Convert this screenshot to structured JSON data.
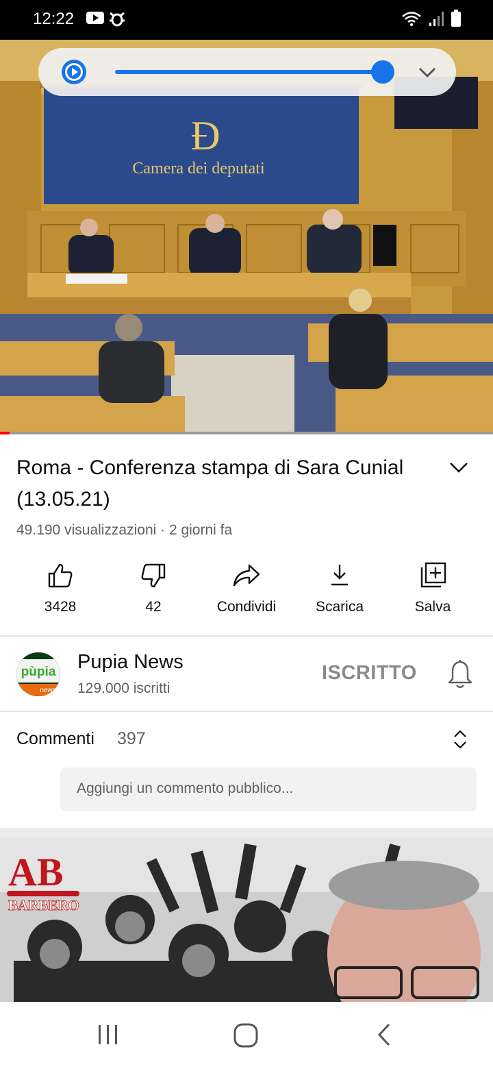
{
  "status_bar": {
    "time": "12:22",
    "left_icons": [
      "youtube-icon",
      "bug-icon"
    ],
    "right_icons": [
      "wifi-icon",
      "signal-icon",
      "battery-icon"
    ]
  },
  "player": {
    "scene_sign": "Camera dei deputati",
    "playback_progress": 0.02,
    "volume_level": 1.0
  },
  "video": {
    "title": "Roma - Conferenza stampa di Sara Cunial (13.05.21)",
    "meta": "49.190 visualizzazioni · 2 giorni fa"
  },
  "actions": [
    {
      "name": "like",
      "label": "3428",
      "icon": "thumb-up-icon"
    },
    {
      "name": "dislike",
      "label": "42",
      "icon": "thumb-down-icon"
    },
    {
      "name": "share",
      "label": "Condividi",
      "icon": "share-icon"
    },
    {
      "name": "download",
      "label": "Scarica",
      "icon": "download-icon"
    },
    {
      "name": "save",
      "label": "Salva",
      "icon": "add-to-playlist-icon"
    }
  ],
  "channel": {
    "name": "Pupia News",
    "subscribers": "129.000 iscritti",
    "subscribe_label": "ISCRITTO",
    "avatar_text": "pùpia",
    "avatar_subtext": "news"
  },
  "comments": {
    "title": "Commenti",
    "count": "397",
    "placeholder": "Aggiungi un commento pubblico..."
  },
  "next_video": {
    "logo_letters": "AB",
    "logo_name": "BARBERO"
  },
  "colors": {
    "accent": "#1a73e8",
    "progress": "#ff0000",
    "secondary_text": "#606060"
  }
}
